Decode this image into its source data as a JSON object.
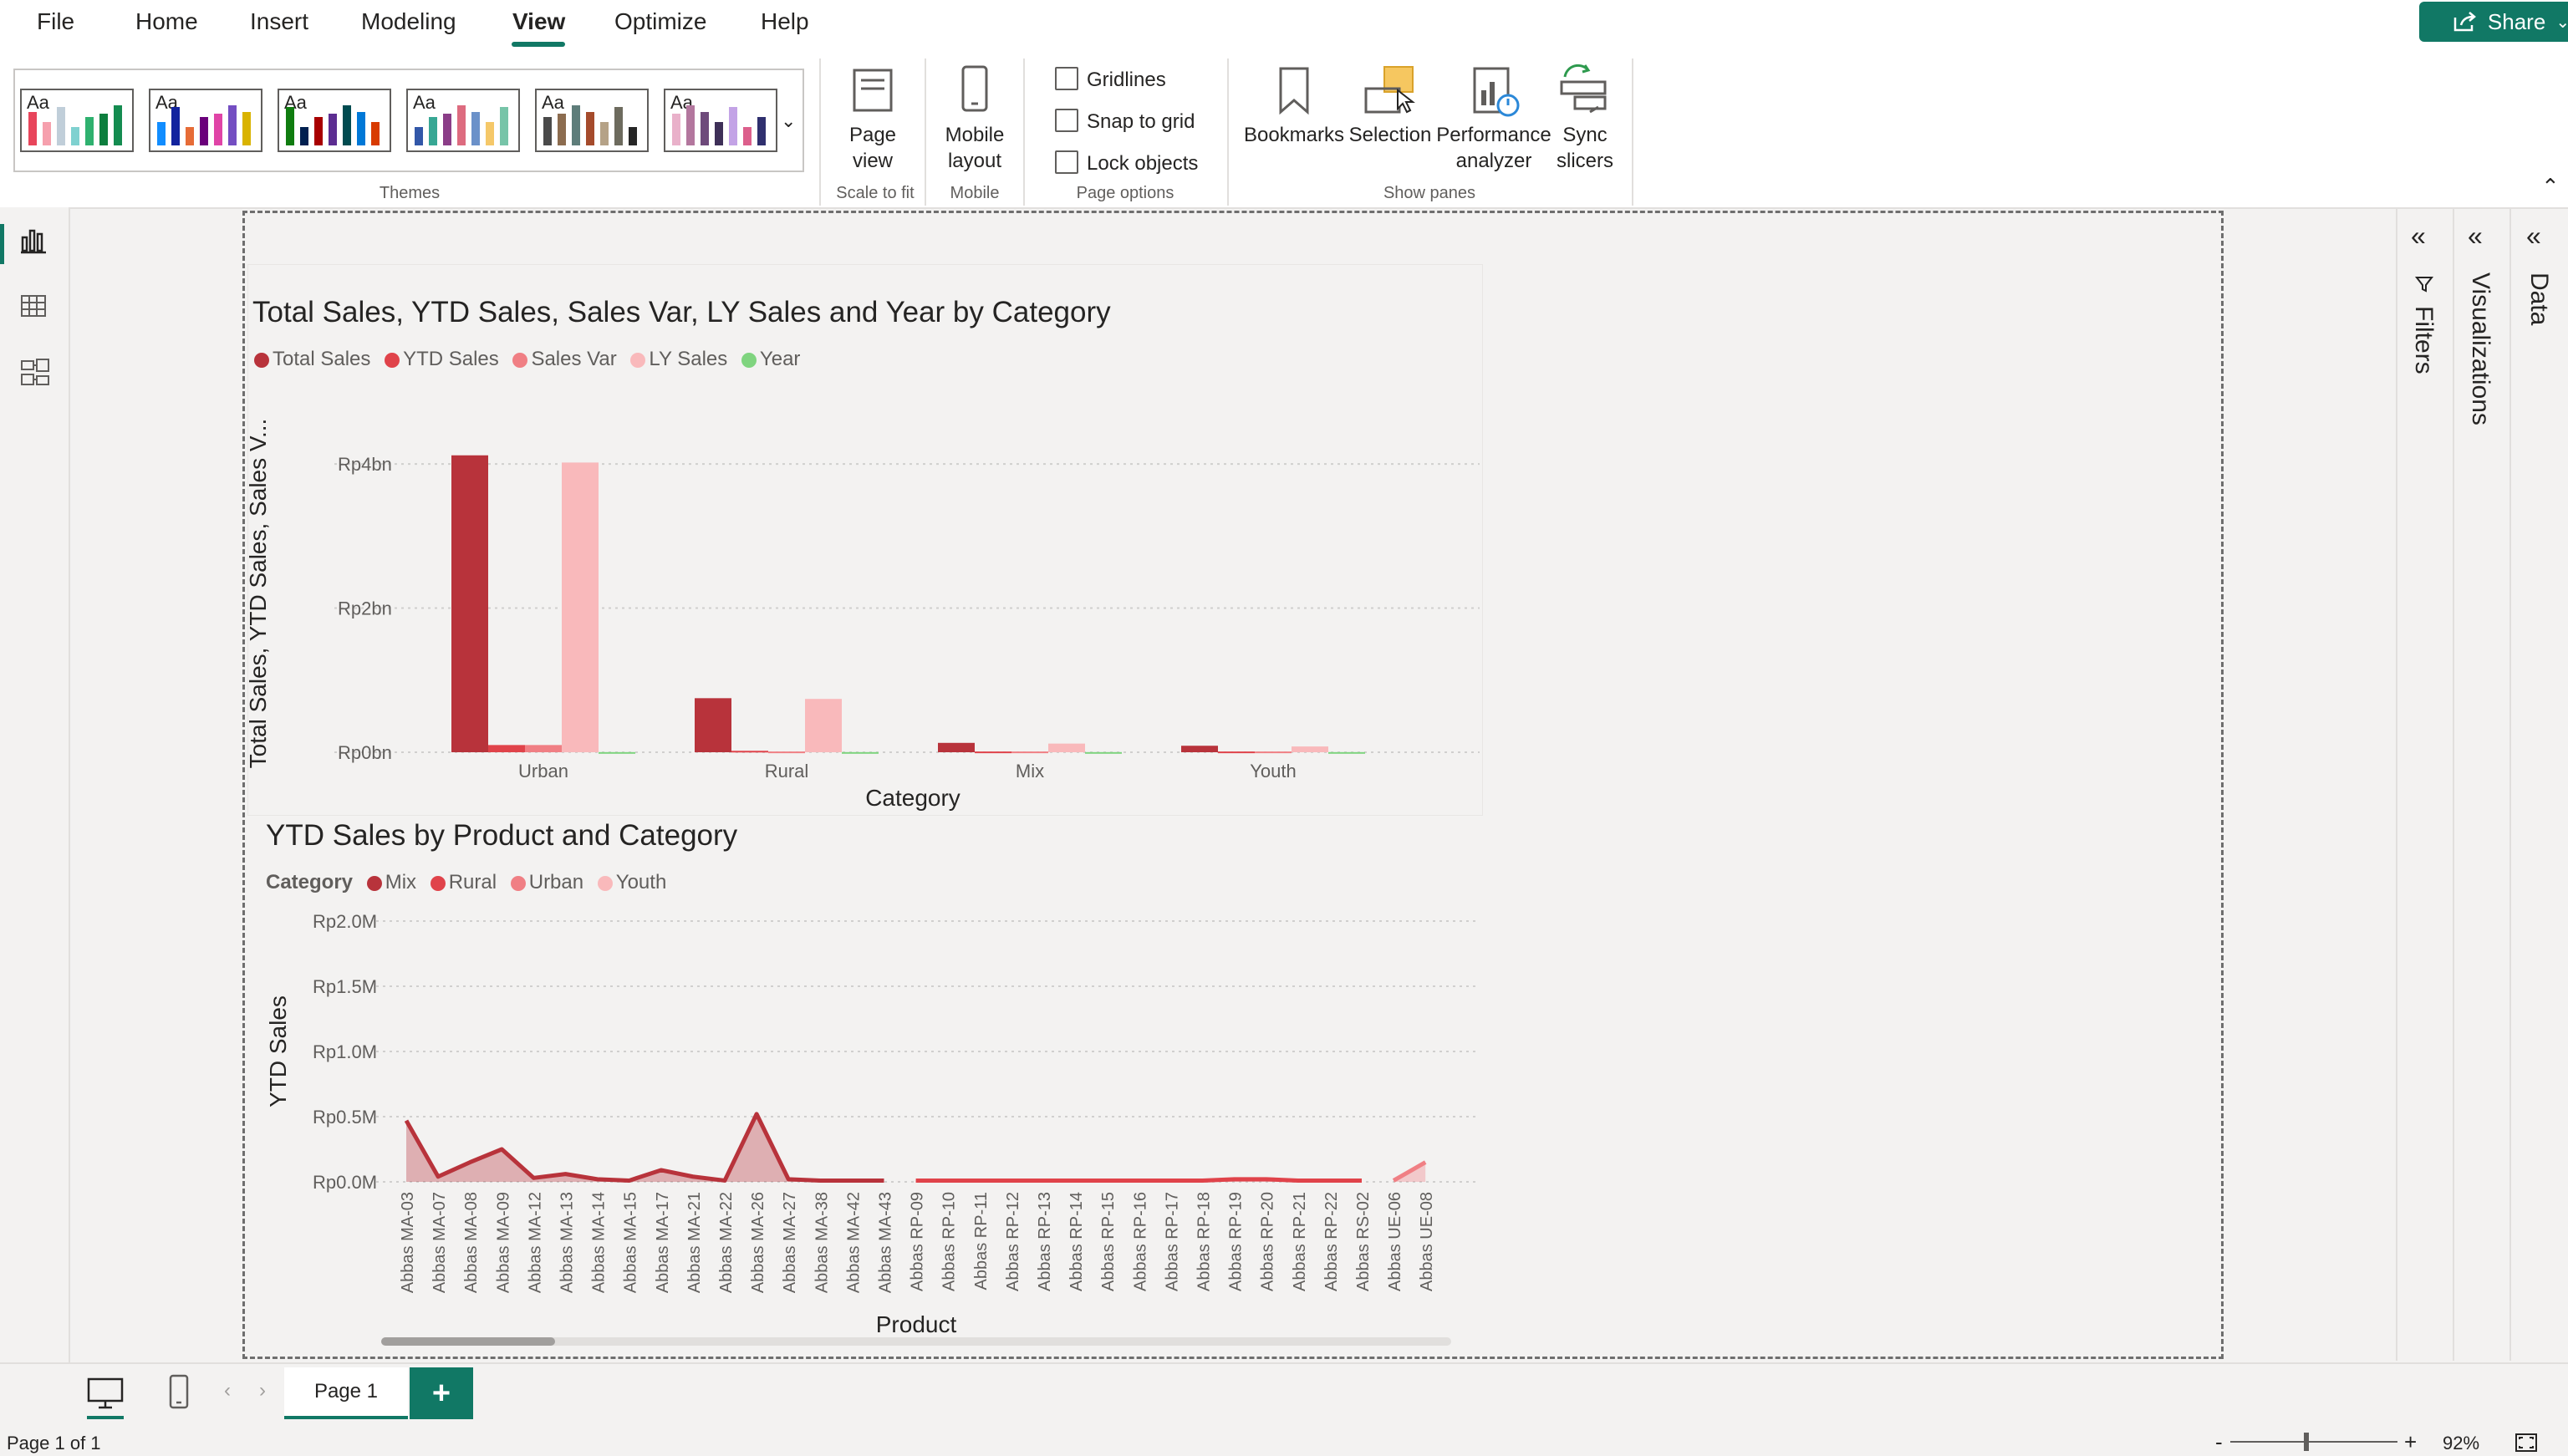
{
  "menu": {
    "tabs": [
      {
        "label": "File"
      },
      {
        "label": "Home"
      },
      {
        "label": "Insert"
      },
      {
        "label": "Modeling"
      },
      {
        "label": "View"
      },
      {
        "label": "Optimize"
      },
      {
        "label": "Help"
      }
    ],
    "active_tab": "View",
    "share_label": "Share"
  },
  "ribbon": {
    "themes_label": "Themes",
    "page_view": "Page\nview",
    "scale_to_fit": "Scale to fit",
    "mobile_layout": "Mobile\nlayout",
    "mobile": "Mobile",
    "gridlines": "Gridlines",
    "snap_to_grid": "Snap to grid",
    "lock_objects": "Lock objects",
    "page_options": "Page options",
    "bookmarks": "Bookmarks",
    "selection": "Selection",
    "performance_analyzer": "Performance\nanalyzer",
    "sync_slicers": "Sync\nslicers",
    "show_panes": "Show panes",
    "theme_palettes": [
      [
        "#e8455b",
        "#f6a0ad",
        "#c0ced9",
        "#7fd1d0",
        "#2fb16f",
        "#0d7e3e",
        "#148c50"
      ],
      [
        "#118dff",
        "#12239e",
        "#e66c37",
        "#6b007b",
        "#e044a7",
        "#744ec2",
        "#d9b300"
      ],
      [
        "#107c10",
        "#002050",
        "#a80000",
        "#5c2d91",
        "#004b50",
        "#0078d7",
        "#d83b01"
      ],
      [
        "#3257a8",
        "#37a794",
        "#8b3d88",
        "#dd6b7f",
        "#6b91c9",
        "#f5c869",
        "#77c4a8"
      ],
      [
        "#4a4a4a",
        "#8c6c4f",
        "#5e7d7a",
        "#a54b2c",
        "#b5a287",
        "#6d6b5e",
        "#262626"
      ],
      [
        "#e9b1ca",
        "#b3779e",
        "#6e4a7b",
        "#3e3058",
        "#c3a3e6",
        "#dc5f8c",
        "#2f2f6e"
      ]
    ]
  },
  "panes": {
    "filters": "Filters",
    "visualizations": "Visualizations",
    "data": "Data"
  },
  "visual1": {
    "title": "Total Sales, YTD Sales, Sales Var, LY Sales and Year by Category",
    "legend": [
      {
        "name": "Total Sales",
        "color": "#b8333b"
      },
      {
        "name": "YTD Sales",
        "color": "#e0434a"
      },
      {
        "name": "Sales Var",
        "color": "#f07f84"
      },
      {
        "name": "LY Sales",
        "color": "#f9b9bb"
      },
      {
        "name": "Year",
        "color": "#7fd47f"
      }
    ]
  },
  "visual2": {
    "title": "YTD Sales by Product and Category",
    "legend_title": "Category",
    "legend": [
      {
        "name": "Mix",
        "color": "#b8333b"
      },
      {
        "name": "Rural",
        "color": "#e0434a"
      },
      {
        "name": "Urban",
        "color": "#f07f84"
      },
      {
        "name": "Youth",
        "color": "#f9b9bb"
      }
    ]
  },
  "chart_data": [
    {
      "type": "bar",
      "title": "Total Sales, YTD Sales, Sales Var, LY Sales and Year by Category",
      "xlabel": "Category",
      "ylabel": "Total Sales, YTD Sales, Sales V...",
      "categories": [
        "Urban",
        "Rural",
        "Mix",
        "Youth"
      ],
      "yticks": [
        "Rp0bn",
        "Rp2bn",
        "Rp4bn"
      ],
      "ylim": [
        0,
        4.5
      ],
      "series": [
        {
          "name": "Total Sales",
          "color": "#b8333b",
          "values": [
            4.12,
            0.75,
            0.13,
            0.09
          ]
        },
        {
          "name": "YTD Sales",
          "color": "#e0434a",
          "values": [
            0.1,
            0.02,
            0.01,
            0.01
          ]
        },
        {
          "name": "Sales Var",
          "color": "#f07f84",
          "values": [
            0.1,
            0.01,
            0.01,
            0.01
          ]
        },
        {
          "name": "LY Sales",
          "color": "#f9b9bb",
          "values": [
            4.02,
            0.74,
            0.12,
            0.08
          ]
        },
        {
          "name": "Year",
          "color": "#7fd47f",
          "values": [
            0.002,
            0.002,
            0.002,
            0.002
          ]
        }
      ],
      "legend_position": "top-left",
      "grid": true
    },
    {
      "type": "area",
      "title": "YTD Sales by Product and Category",
      "xlabel": "Product",
      "ylabel": "YTD Sales",
      "yticks": [
        "Rp0.0M",
        "Rp0.5M",
        "Rp1.0M",
        "Rp1.5M",
        "Rp2.0M"
      ],
      "ylim": [
        0,
        2.0
      ],
      "legend_title": "Category",
      "categories": [
        "Abbas MA-03",
        "Abbas MA-07",
        "Abbas MA-08",
        "Abbas MA-09",
        "Abbas MA-12",
        "Abbas MA-13",
        "Abbas MA-14",
        "Abbas MA-15",
        "Abbas MA-17",
        "Abbas MA-21",
        "Abbas MA-22",
        "Abbas MA-26",
        "Abbas MA-27",
        "Abbas MA-38",
        "Abbas MA-42",
        "Abbas MA-43",
        "Abbas RP-09",
        "Abbas RP-10",
        "Abbas RP-11",
        "Abbas RP-12",
        "Abbas RP-13",
        "Abbas RP-14",
        "Abbas RP-15",
        "Abbas RP-16",
        "Abbas RP-17",
        "Abbas RP-18",
        "Abbas RP-19",
        "Abbas RP-20",
        "Abbas RP-21",
        "Abbas RP-22",
        "Abbas RS-02",
        "Abbas UE-06",
        "Abbas UE-08"
      ],
      "series": [
        {
          "name": "Mix",
          "color": "#b8333b",
          "values": [
            0.47,
            0.04,
            0.15,
            0.25,
            0.03,
            0.06,
            0.02,
            0.01,
            0.09,
            0.04,
            0.01,
            0.52,
            0.02,
            0.01,
            0.01,
            0.01,
            null,
            null,
            null,
            null,
            null,
            null,
            null,
            null,
            null,
            null,
            null,
            null,
            null,
            null,
            null,
            null,
            null
          ]
        },
        {
          "name": "Rural",
          "color": "#e0434a",
          "values": [
            null,
            null,
            null,
            null,
            null,
            null,
            null,
            null,
            null,
            null,
            null,
            null,
            null,
            null,
            null,
            null,
            0.01,
            0.01,
            0.01,
            0.01,
            0.01,
            0.01,
            0.01,
            0.01,
            0.01,
            0.01,
            0.02,
            0.02,
            0.01,
            0.01,
            0.01,
            null,
            null
          ]
        },
        {
          "name": "Urban",
          "color": "#f07f84",
          "values": [
            null,
            null,
            null,
            null,
            null,
            null,
            null,
            null,
            null,
            null,
            null,
            null,
            null,
            null,
            null,
            null,
            null,
            null,
            null,
            null,
            null,
            null,
            null,
            null,
            null,
            null,
            null,
            null,
            null,
            null,
            null,
            0.01,
            0.15
          ]
        },
        {
          "name": "Youth",
          "color": "#f9b9bb",
          "values": [
            null,
            null,
            null,
            null,
            null,
            null,
            null,
            null,
            null,
            null,
            null,
            null,
            null,
            null,
            null,
            null,
            null,
            null,
            null,
            null,
            null,
            null,
            null,
            null,
            null,
            null,
            null,
            null,
            null,
            null,
            null,
            null,
            null
          ]
        }
      ],
      "legend_position": "top-left",
      "grid": true
    }
  ],
  "bottom": {
    "page_tab": "Page 1",
    "add_page": "+",
    "status": "Page 1 of 1",
    "zoom": "92%"
  }
}
